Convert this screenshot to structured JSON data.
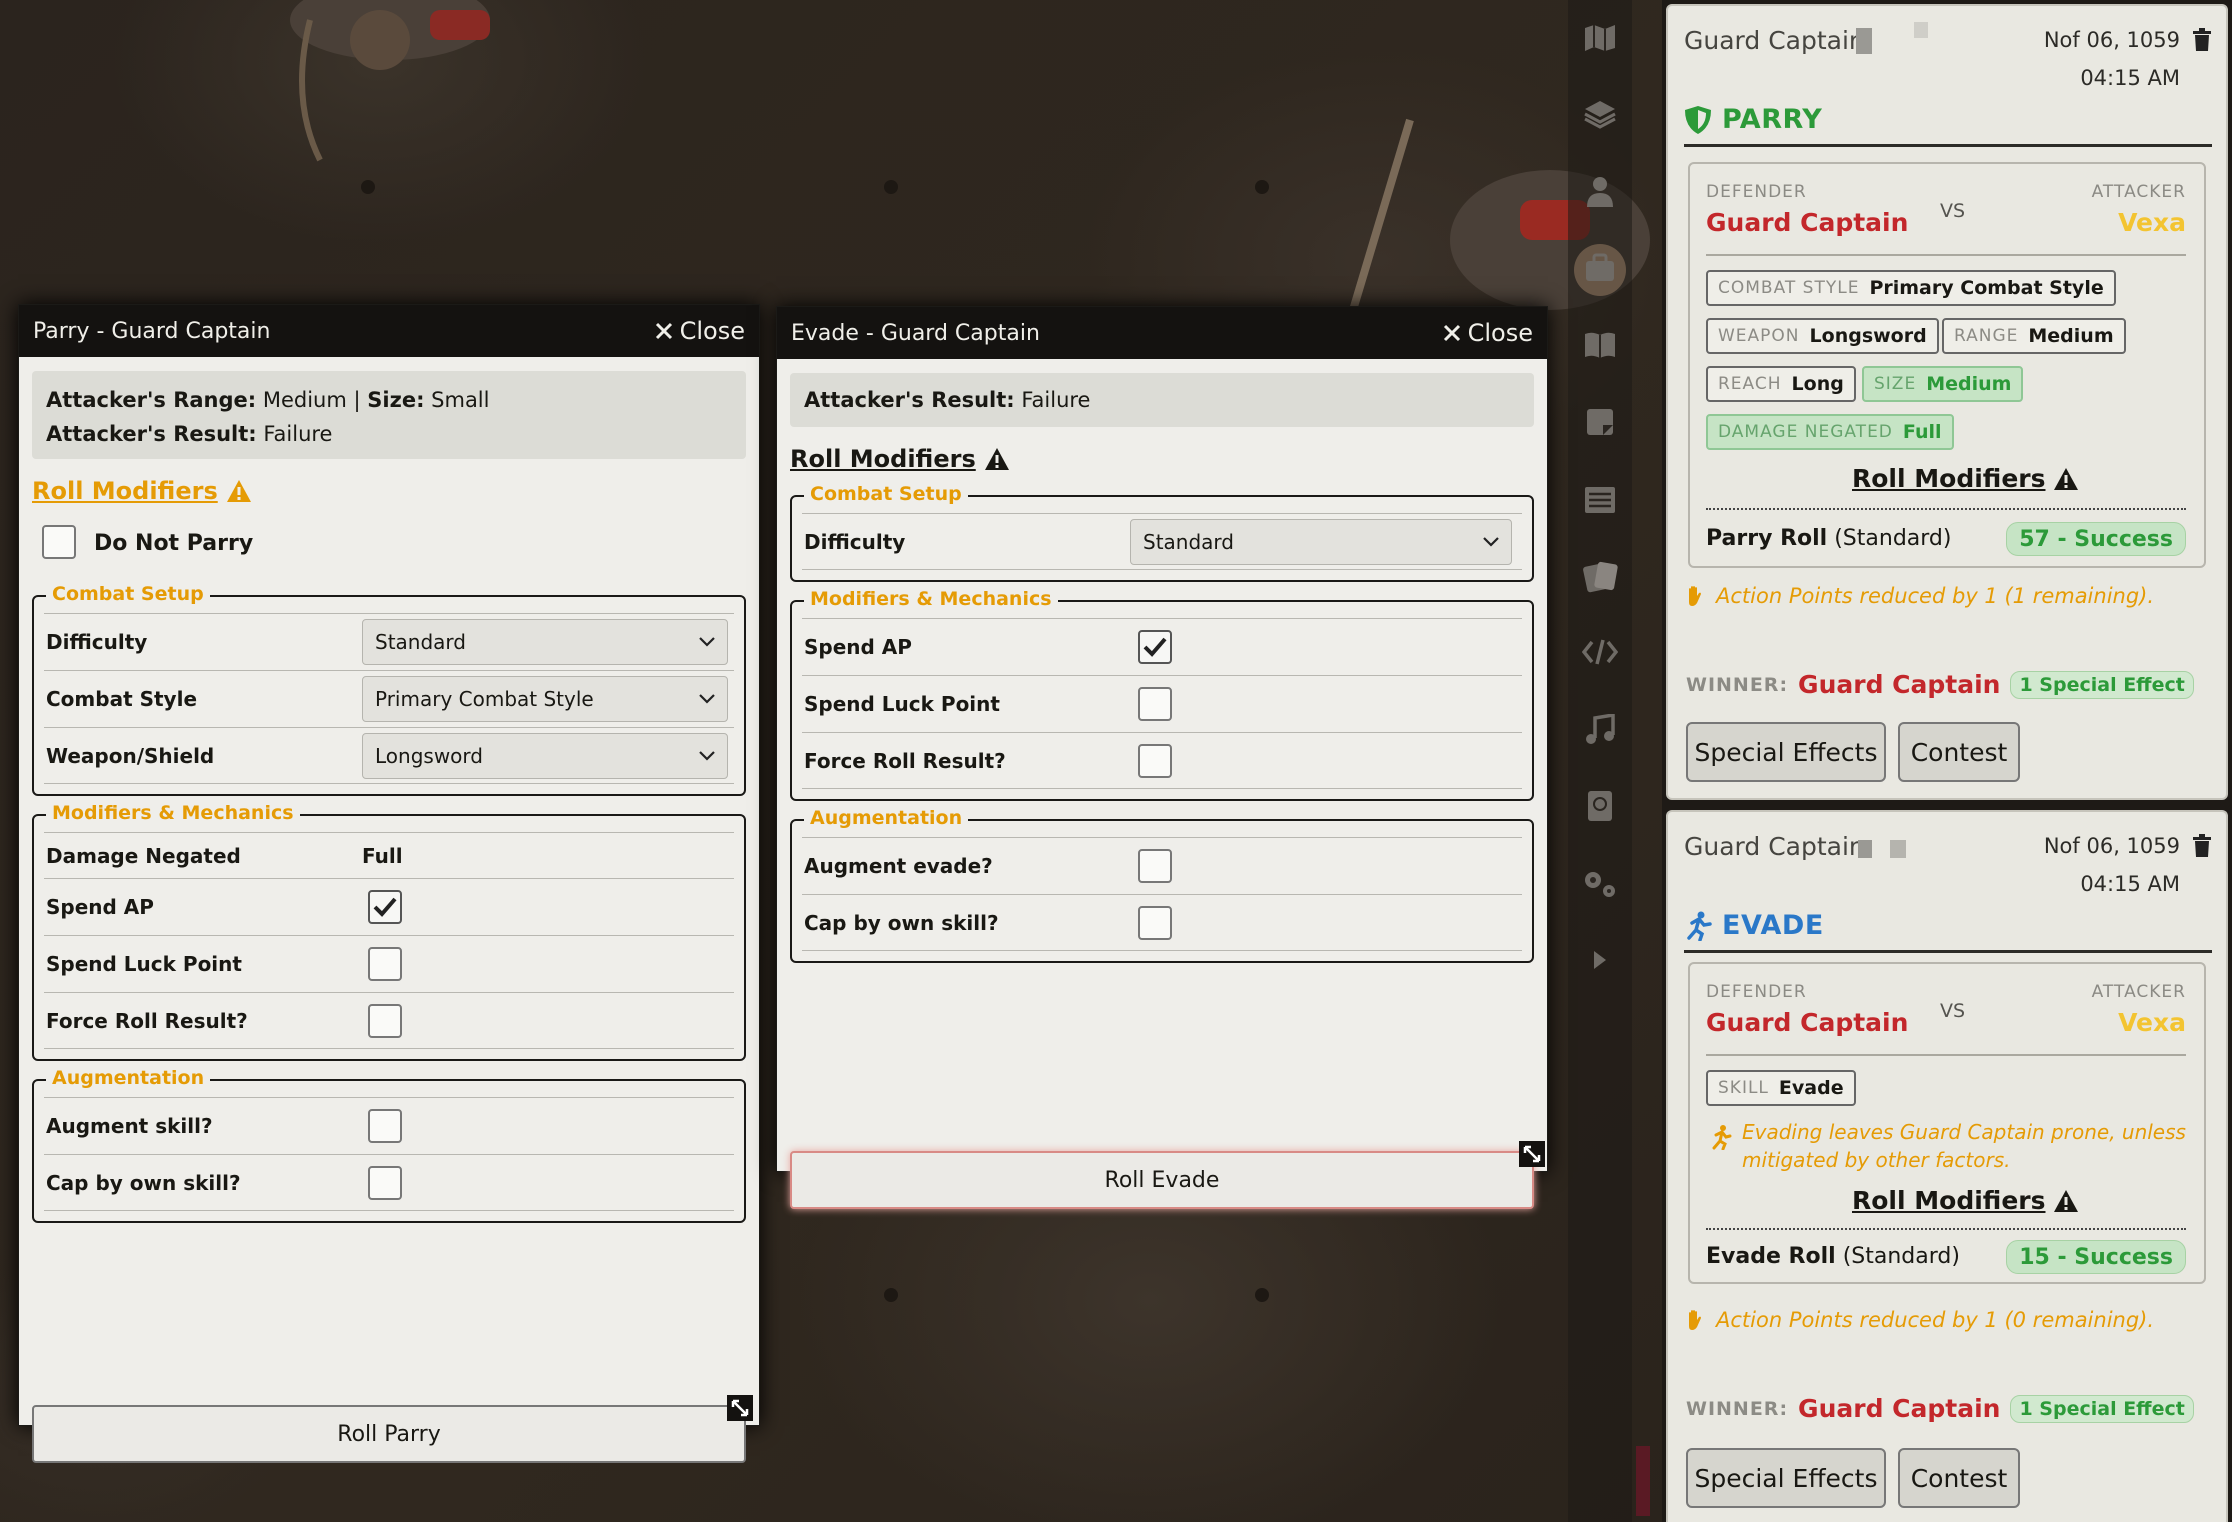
{
  "parry_window": {
    "title": "Parry - Guard Captain",
    "close_label": "Close",
    "info": {
      "range_label": "Attacker's Range:",
      "range_value": "Medium",
      "separator": "|",
      "size_label": "Size:",
      "size_value": "Small",
      "result_label": "Attacker's Result:",
      "result_value": "Failure"
    },
    "roll_modifiers_label": "Roll Modifiers",
    "do_not_parry_label": "Do Not Parry",
    "combat_setup": {
      "legend": "Combat Setup",
      "difficulty_label": "Difficulty",
      "difficulty_value": "Standard",
      "combat_style_label": "Combat Style",
      "combat_style_value": "Primary Combat Style",
      "weapon_label": "Weapon/Shield",
      "weapon_value": "Longsword"
    },
    "modifiers": {
      "legend": "Modifiers & Mechanics",
      "damage_negated_label": "Damage Negated",
      "damage_negated_value": "Full",
      "spend_ap_label": "Spend AP",
      "spend_ap_checked": true,
      "spend_luck_label": "Spend Luck Point",
      "spend_luck_checked": false,
      "force_roll_label": "Force Roll Result?",
      "force_roll_checked": false
    },
    "augmentation": {
      "legend": "Augmentation",
      "augment_label": "Augment skill?",
      "cap_label": "Cap by own skill?"
    },
    "roll_button": "Roll Parry"
  },
  "evade_window": {
    "title": "Evade - Guard Captain",
    "close_label": "Close",
    "info": {
      "result_label": "Attacker's Result:",
      "result_value": "Failure"
    },
    "roll_modifiers_label": "Roll Modifiers",
    "combat_setup": {
      "legend": "Combat Setup",
      "difficulty_label": "Difficulty",
      "difficulty_value": "Standard"
    },
    "modifiers": {
      "legend": "Modifiers & Mechanics",
      "spend_ap_label": "Spend AP",
      "spend_ap_checked": true,
      "spend_luck_label": "Spend Luck Point",
      "force_roll_label": "Force Roll Result?"
    },
    "augmentation": {
      "legend": "Augmentation",
      "augment_label": "Augment evade?",
      "cap_label": "Cap by own skill?"
    },
    "roll_button": "Roll Evade"
  },
  "sidebar_icons": [
    "map-icon",
    "layers-icon",
    "actor-icon",
    "items-icon",
    "journal-icon",
    "notes-icon",
    "list-icon",
    "cards-icon",
    "code-icon",
    "music-icon",
    "compendium-icon",
    "settings-icon",
    "collapse-icon"
  ],
  "chat": {
    "parry_card": {
      "speaker": "Guard Captain",
      "date": "Nof 06, 1059",
      "time": "04:15 AM",
      "type": "PARRY",
      "defender_label": "DEFENDER",
      "defender": "Guard Captain",
      "vs": "VS",
      "attacker_label": "ATTACKER",
      "attacker": "Vexa",
      "tags": {
        "combat_style_key": "COMBAT STYLE",
        "combat_style_val": "Primary Combat Style",
        "weapon_key": "WEAPON",
        "weapon_val": "Longsword",
        "range_key": "RANGE",
        "range_val": "Medium",
        "reach_key": "REACH",
        "reach_val": "Long",
        "size_key": "SIZE",
        "size_val": "Medium",
        "damage_key": "DAMAGE NEGATED",
        "damage_val": "Full"
      },
      "roll_modifiers": "Roll Modifiers",
      "roll_name": "Parry Roll",
      "roll_difficulty": "(Standard)",
      "roll_result": "57 - Success",
      "ap_note": "Action Points reduced by 1 (1 remaining).",
      "winner_label": "WINNER:",
      "winner": "Guard Captain",
      "special_effect": "1 Special Effect",
      "special_effects_btn": "Special Effects",
      "contest_btn": "Contest"
    },
    "evade_card": {
      "speaker": "Guard Captain",
      "date": "Nof 06, 1059",
      "time": "04:15 AM",
      "type": "EVADE",
      "defender_label": "DEFENDER",
      "defender": "Guard Captain",
      "vs": "VS",
      "attacker_label": "ATTACKER",
      "attacker": "Vexa",
      "tags": {
        "skill_key": "SKILL",
        "skill_val": "Evade"
      },
      "evade_note_1": "Evading leaves Guard Captain prone, unless",
      "evade_note_2": "mitigated by other factors.",
      "roll_modifiers": "Roll Modifiers",
      "roll_name": "Evade Roll",
      "roll_difficulty": "(Standard)",
      "roll_result": "15 - Success",
      "ap_note": "Action Points reduced by 1 (0 remaining).",
      "winner_label": "WINNER:",
      "winner": "Guard Captain",
      "special_effect": "1 Special Effect",
      "special_effects_btn": "Special Effects",
      "contest_btn": "Contest"
    }
  },
  "colors": {
    "accent_gold": "#e59b05",
    "defender_red": "#c3272b",
    "attacker_gold": "#f3c431",
    "success_green": "#2c9a39",
    "evade_blue": "#2a78c8"
  }
}
